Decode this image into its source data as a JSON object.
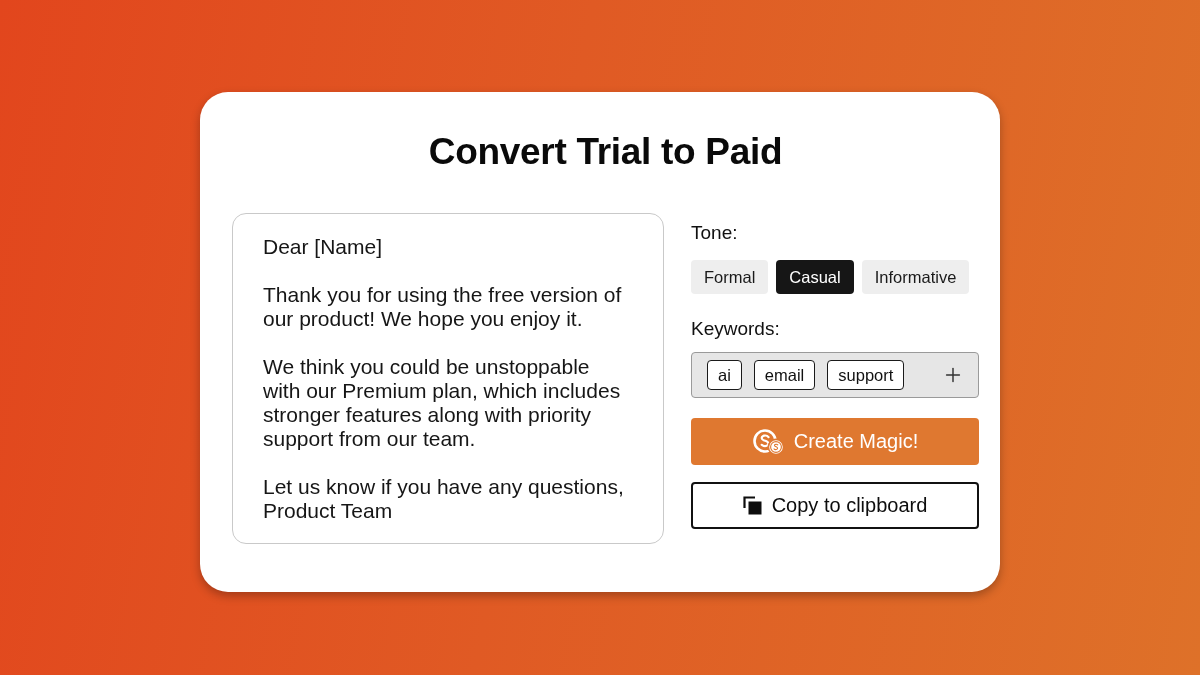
{
  "card": {
    "title": "Convert Trial to Paid"
  },
  "message": {
    "paragraphs": [
      "Dear [Name]",
      "Thank you for using the free version of\nour product! We hope you enjoy it.",
      "We think you could be unstoppable\nwith our Premium plan, which includes\nstronger features along with priority\nsupport from our team.",
      "Let us know if you have any questions,\nProduct Team"
    ]
  },
  "tone": {
    "label": "Tone:",
    "options": [
      {
        "label": "Formal",
        "selected": false
      },
      {
        "label": "Casual",
        "selected": true
      },
      {
        "label": "Informative",
        "selected": false
      }
    ]
  },
  "keywords": {
    "label": "Keywords:",
    "tags": [
      "ai",
      "email",
      "support"
    ]
  },
  "buttons": [
    {
      "kind": "primary",
      "label": "Create Magic!"
    },
    {
      "kind": "outline",
      "label": "Copy to clipboard"
    }
  ]
}
